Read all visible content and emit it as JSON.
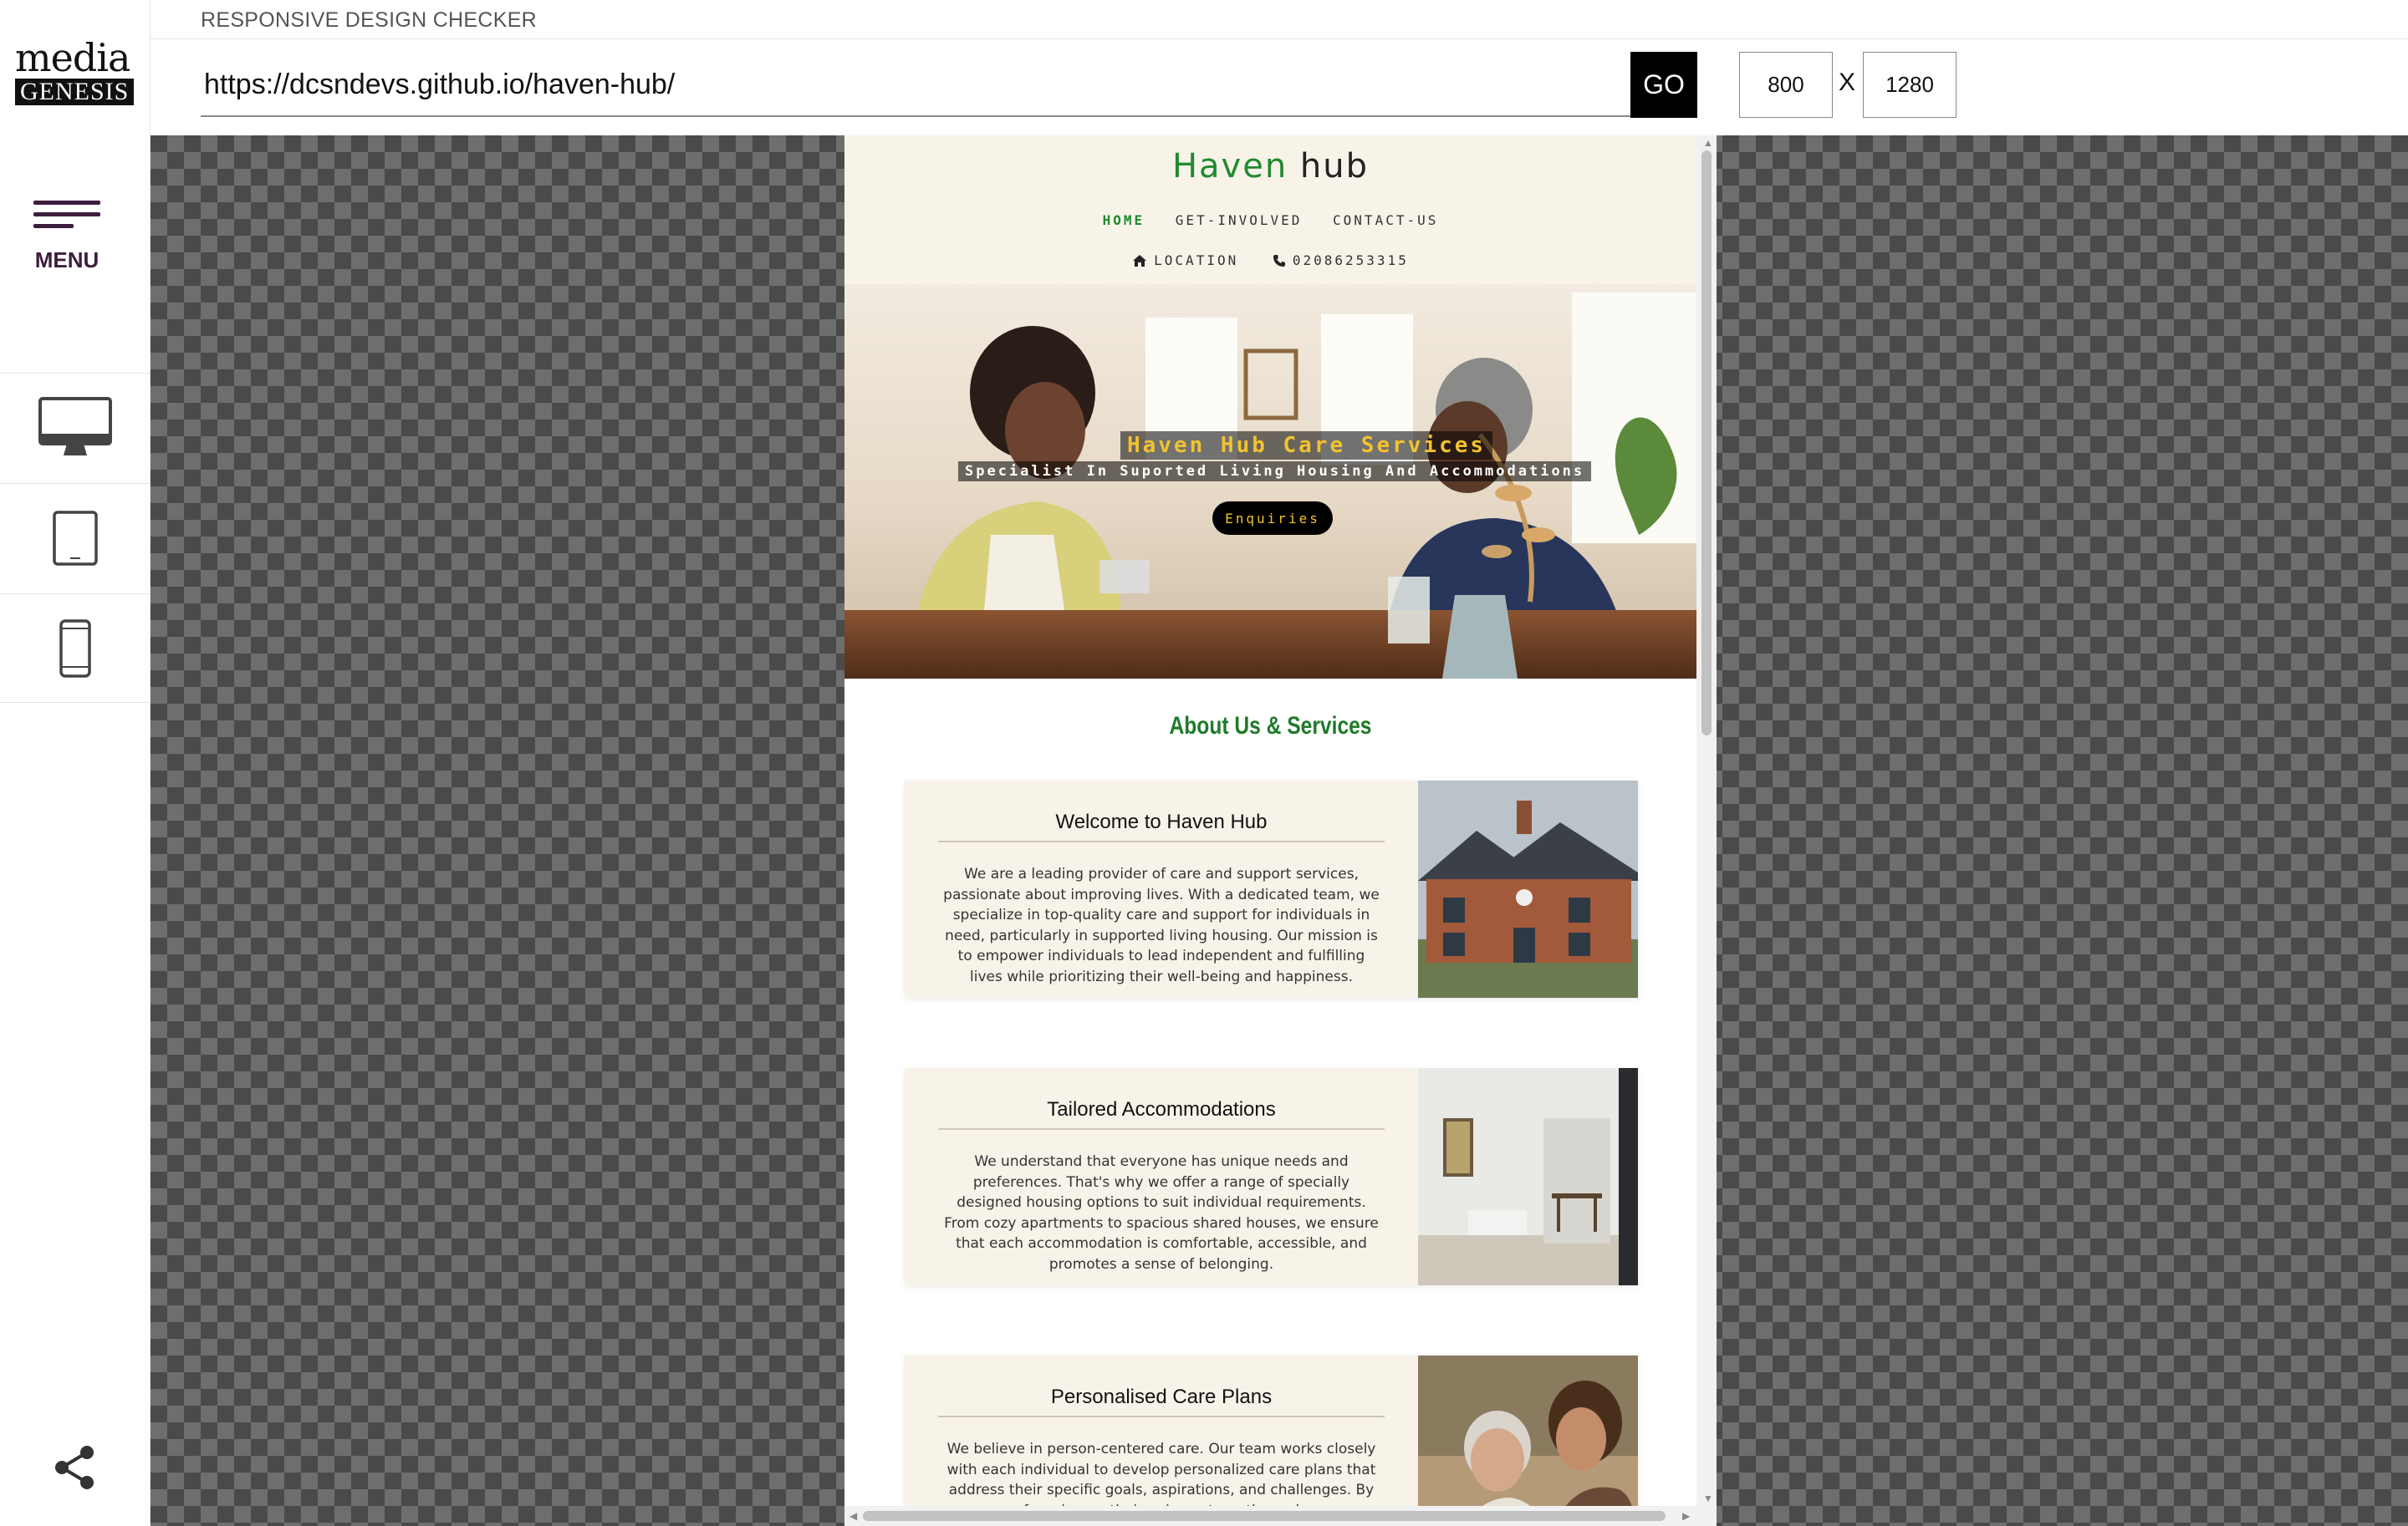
{
  "sidebar": {
    "logo_top": "media",
    "logo_bottom": "GENESIS",
    "menu_label": "MENU"
  },
  "header": {
    "app_title": "RESPONSIVE DESIGN CHECKER",
    "url_value": "https://dcsndevs.github.io/haven-hub/",
    "go_label": "GO",
    "width_value": "800",
    "x_label": "X",
    "height_value": "1280"
  },
  "site": {
    "brand_first": "Haven",
    "brand_second": "hub",
    "nav": [
      "HOME",
      "GET-INVOLVED",
      "CONTACT-US"
    ],
    "location_label": "LOCATION",
    "phone": "02086253315",
    "hero_title": "Haven Hub Care Services",
    "hero_subtitle": "Specialist In Suported Living Housing And Accommodations",
    "hero_button": "Enquiries",
    "section_title": "About Us & Services",
    "cards": [
      {
        "title": "Welcome to Haven Hub",
        "body": "We are a leading provider of care and support services, passionate about improving lives. With a dedicated team, we specialize in top-quality care and support for individuals in need, particularly in supported living housing. Our mission is to empower individuals to lead independent and fulfilling lives while prioritizing their well-being and happiness."
      },
      {
        "title": "Tailored Accommodations",
        "body": "We understand that everyone has unique needs and preferences. That's why we offer a range of specially designed housing options to suit individual requirements. From cozy apartments to spacious shared houses, we ensure that each accommodation is comfortable, accessible, and promotes a sense of belonging."
      },
      {
        "title": "Personalised Care Plans",
        "body": "We believe in person-centered care. Our team works closely with each individual to develop personalized care plans that address their specific goals, aspirations, and challenges. By focusing on their unique strengths and"
      }
    ]
  },
  "colors": {
    "brand_green": "#1f8a2e",
    "accent_purple": "#3d1d3d",
    "hero_gold": "#f2c230",
    "card_bg": "#f8f3e9"
  },
  "icons": [
    "menu-icon",
    "desktop-icon",
    "tablet-icon",
    "mobile-icon",
    "share-icon",
    "home-icon",
    "phone-icon"
  ]
}
